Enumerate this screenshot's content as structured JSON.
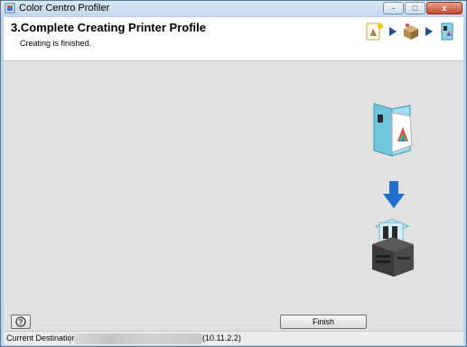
{
  "window": {
    "title": "Color Centro Profiler",
    "controls": {
      "minimize": "-",
      "maximize": "□",
      "close": "x"
    }
  },
  "header": {
    "title": "3.Complete Creating Printer Profile",
    "subtitle": "Creating is finished.",
    "step_icons": [
      "measure-chart-icon",
      "printer-box-icon",
      "profile-complete-icon"
    ]
  },
  "main": {
    "graphic_icons": [
      "profile-folder-icon",
      "down-arrow-icon",
      "printer-icon"
    ]
  },
  "buttons": {
    "help": "?",
    "finish": "Finish"
  },
  "statusbar": {
    "destination_label": "Current Destination",
    "destination_ip": "(10.11.2.2)"
  },
  "colors": {
    "arrow_blue": "#1f6fd0",
    "folder_teal": "#6fc6dc",
    "printer_dark": "#3a3a3a"
  }
}
